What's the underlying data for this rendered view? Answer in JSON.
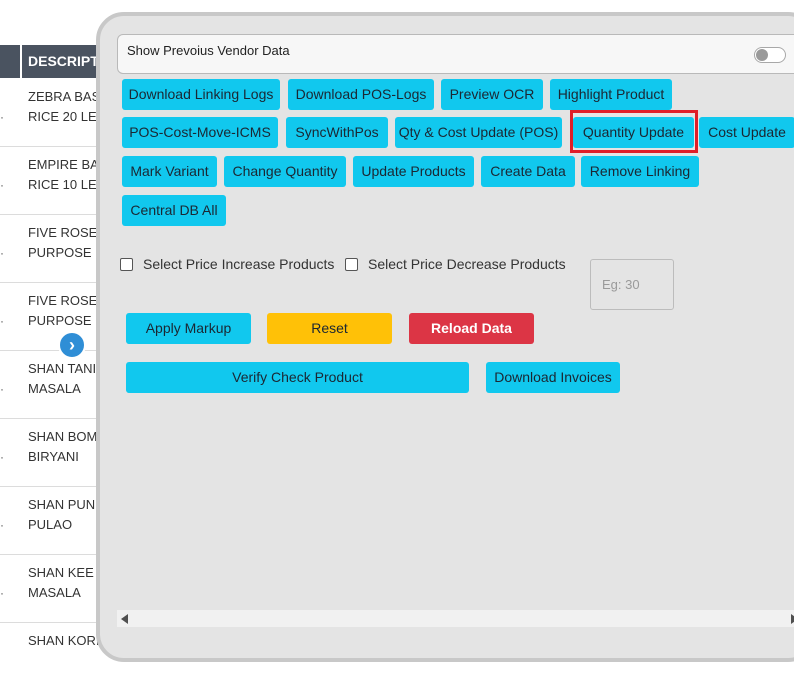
{
  "table": {
    "header": "DESCRIPT",
    "rows": [
      {
        "line1": "ZEBRA BAS",
        "line2": "RICE 20 LE"
      },
      {
        "line1": "EMPIRE BA",
        "line2": "RICE 10 LE"
      },
      {
        "line1": "FIVE ROSE",
        "line2": "PURPOSE"
      },
      {
        "line1": "FIVE ROSE",
        "line2": "PURPOSE"
      },
      {
        "line1": "SHAN TANI",
        "line2": "MASALA"
      },
      {
        "line1": "SHAN BOM",
        "line2": "BIRYANI"
      },
      {
        "line1": "SHAN PUN",
        "line2": "PULAO"
      },
      {
        "line1": "SHAN KEE",
        "line2": "MASALA"
      },
      {
        "line1": "SHAN KORI",
        "line2": ""
      }
    ],
    "row_marker": "·",
    "nav_icon": "chevron-right-icon",
    "nav_glyph": "›"
  },
  "panel": {
    "vendor_label": "Show Prevoius Vendor Data",
    "buttons": {
      "download_linking_logs": "Download Linking Logs",
      "download_pos_logs": "Download POS-Logs",
      "preview_ocr": "Preview OCR",
      "highlight_product": "Highlight Product",
      "pos_cost_move_icms": "POS-Cost-Move-ICMS",
      "sync_with_pos": "SyncWithPos",
      "qty_cost_update_pos": "Qty & Cost Update (POS)",
      "quantity_update": "Quantity Update",
      "cost_update": "Cost Update",
      "mark_variant": "Mark Variant",
      "change_quantity": "Change Quantity",
      "update_products": "Update Products",
      "create_data": "Create Data",
      "remove_linking": "Remove Linking",
      "central_db_all": "Central DB All",
      "apply_markup": "Apply Markup",
      "reset": "Reset",
      "reload_data": "Reload Data",
      "verify_check_product": "Verify Check Product",
      "download_invoices": "Download Invoices"
    },
    "checkboxes": {
      "price_increase": "Select Price Increase Products",
      "price_decrease": "Select Price Decrease Products"
    },
    "markup_placeholder": "Eg: 30",
    "colors": {
      "primary": "#11c8ee",
      "warning": "#ffc107",
      "danger": "#dc3545",
      "highlight_box": "#e01e27",
      "panel_bg": "#e4e4e4"
    }
  }
}
